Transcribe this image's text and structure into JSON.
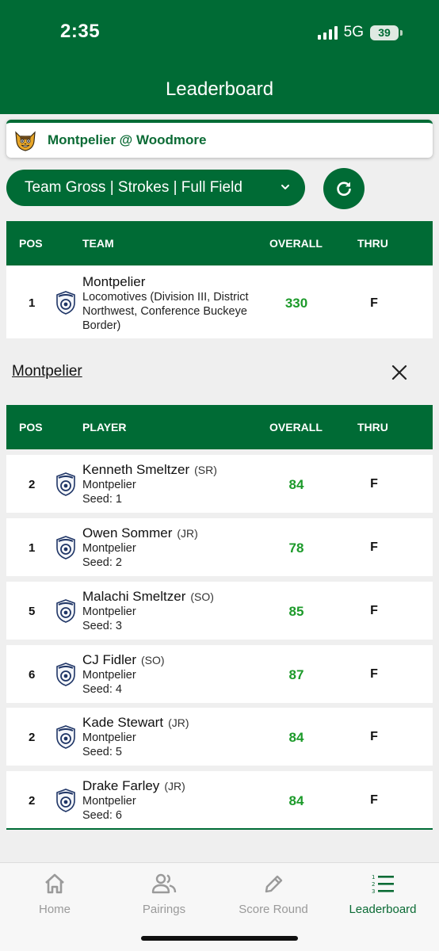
{
  "status": {
    "time": "2:35",
    "network": "5G",
    "battery": "39"
  },
  "header": {
    "title": "Leaderboard"
  },
  "match": {
    "title": "Montpelier @ Woodmore",
    "mascot_icon": "bobcat-mascot-icon"
  },
  "filter": {
    "label": "Team Gross | Strokes | Full Field"
  },
  "team_table": {
    "headers": {
      "pos": "POS",
      "team": "TEAM",
      "overall": "OVERALL",
      "thru": "THRU"
    },
    "rows": [
      {
        "pos": "1",
        "name": "Montpelier",
        "detail": "Locomotives (Division III, District Northwest, Conference Buckeye Border)",
        "overall": "330",
        "thru": "F"
      }
    ]
  },
  "team_section": {
    "name": "Montpelier"
  },
  "player_table": {
    "headers": {
      "pos": "POS",
      "player": "PLAYER",
      "overall": "OVERALL",
      "thru": "THRU"
    },
    "rows": [
      {
        "pos": "2",
        "name": "Kenneth Smeltzer",
        "class": "(SR)",
        "team": "Montpelier",
        "seed": "Seed: 1",
        "overall": "84",
        "thru": "F"
      },
      {
        "pos": "1",
        "name": "Owen Sommer",
        "class": "(JR)",
        "team": "Montpelier",
        "seed": "Seed: 2",
        "overall": "78",
        "thru": "F"
      },
      {
        "pos": "5",
        "name": "Malachi Smeltzer",
        "class": "(SO)",
        "team": "Montpelier",
        "seed": "Seed: 3",
        "overall": "85",
        "thru": "F"
      },
      {
        "pos": "6",
        "name": "CJ Fidler",
        "class": "(SO)",
        "team": "Montpelier",
        "seed": "Seed: 4",
        "overall": "87",
        "thru": "F"
      },
      {
        "pos": "2",
        "name": "Kade Stewart",
        "class": "(JR)",
        "team": "Montpelier",
        "seed": "Seed: 5",
        "overall": "84",
        "thru": "F"
      },
      {
        "pos": "2",
        "name": "Drake Farley",
        "class": "(JR)",
        "team": "Montpelier",
        "seed": "Seed: 6",
        "overall": "84",
        "thru": "F"
      }
    ]
  },
  "nav": [
    {
      "label": "Home",
      "icon": "home-icon",
      "active": false
    },
    {
      "label": "Pairings",
      "icon": "people-icon",
      "active": false
    },
    {
      "label": "Score Round",
      "icon": "pencil-icon",
      "active": false
    },
    {
      "label": "Leaderboard",
      "icon": "ranked-list-icon",
      "active": true
    }
  ],
  "colors": {
    "brand_green": "#006b35",
    "score_green": "#1c9a2a",
    "inactive": "#9a9a9a"
  }
}
